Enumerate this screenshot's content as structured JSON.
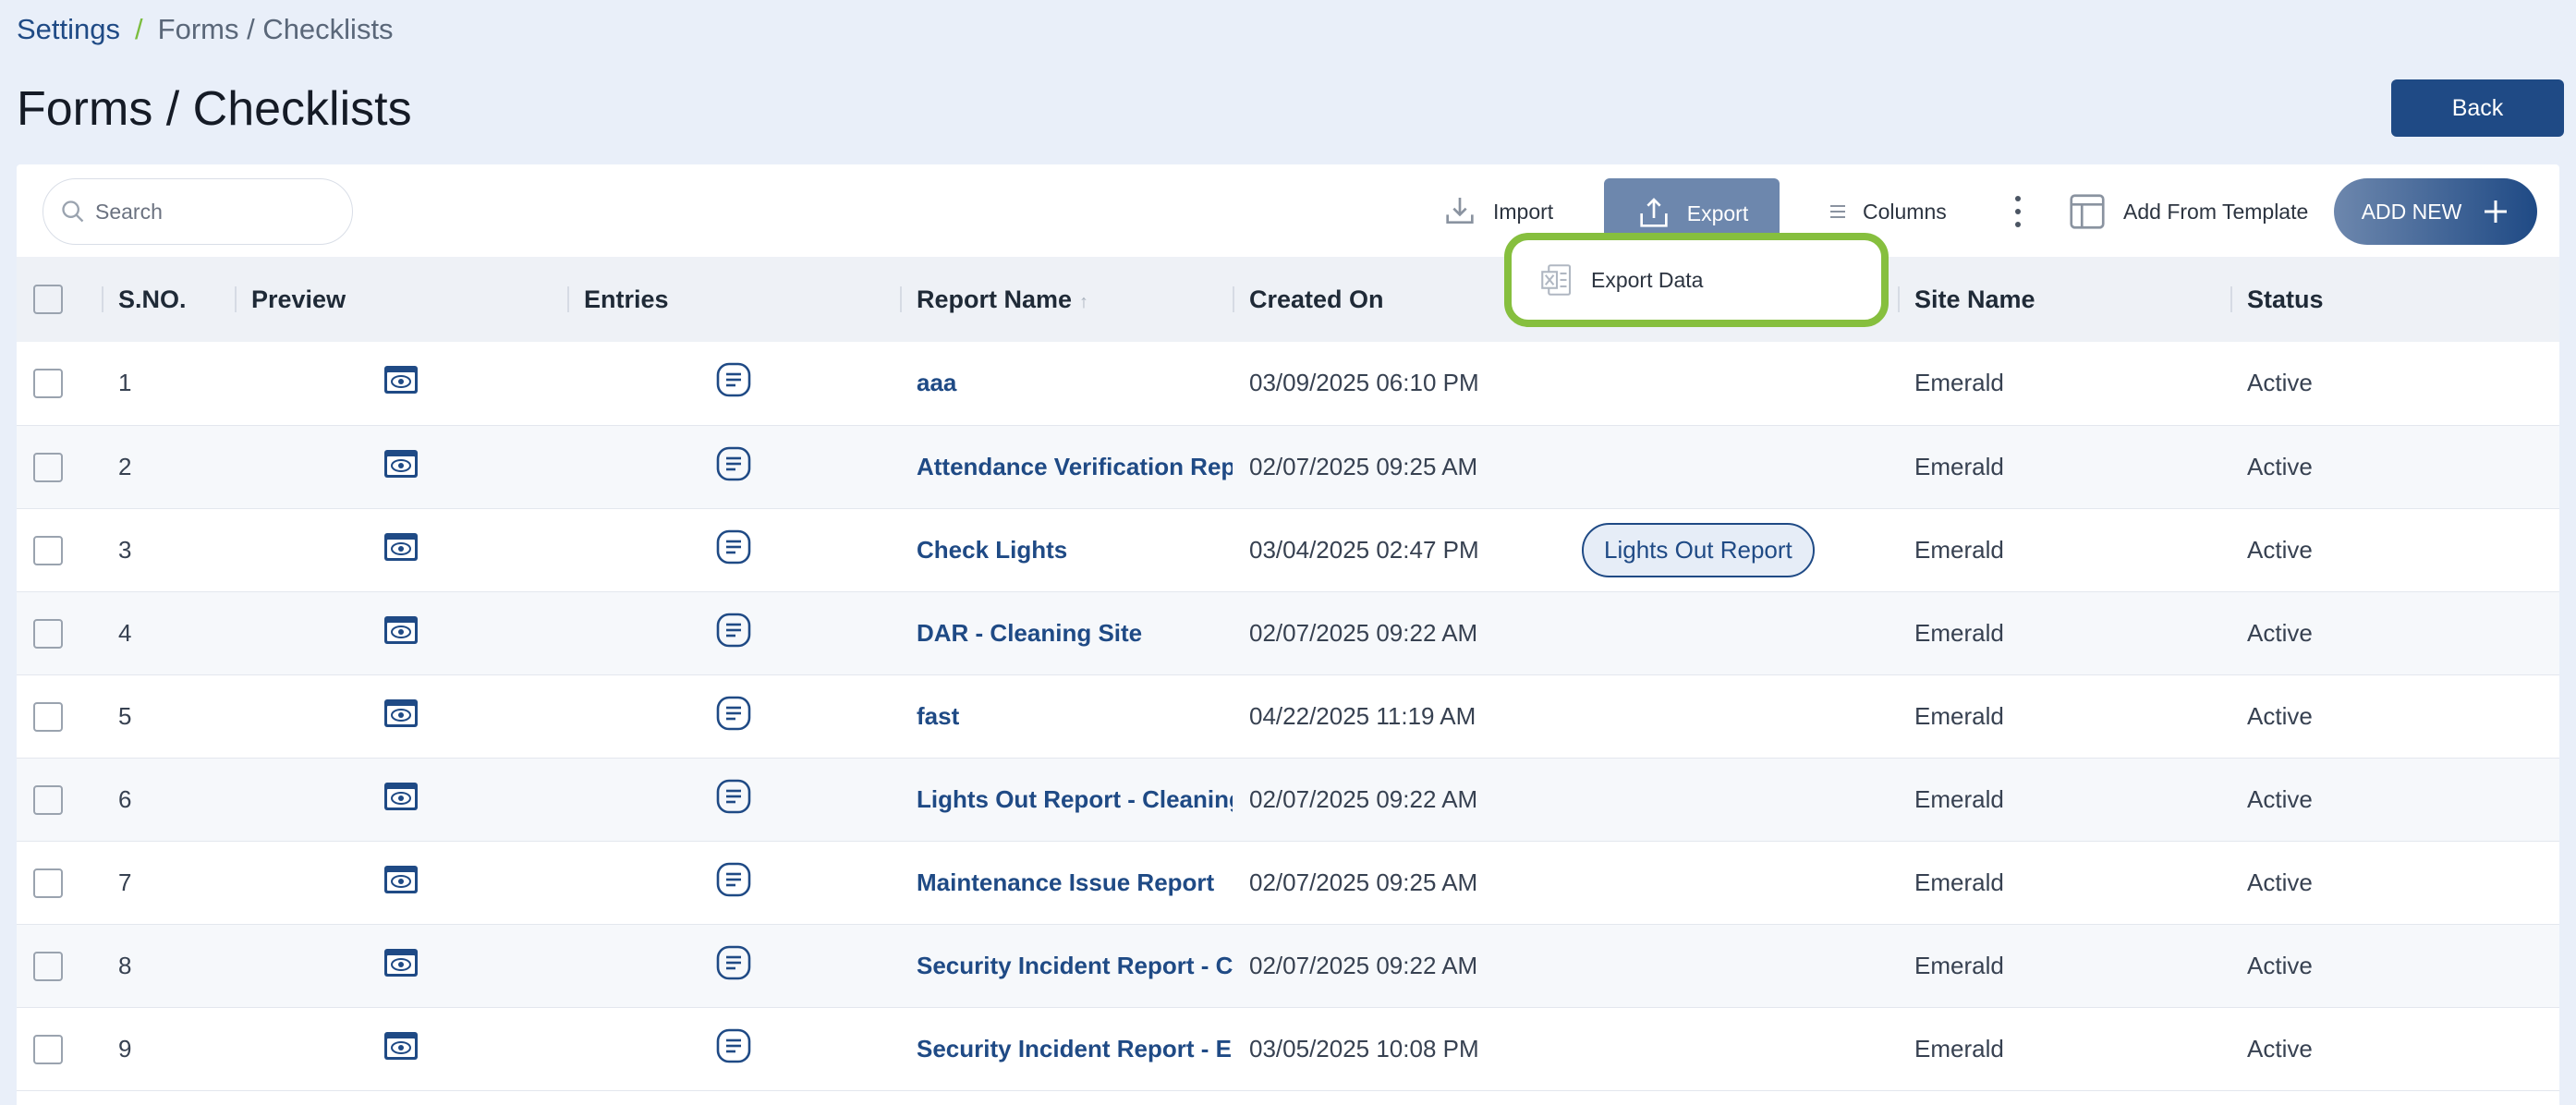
{
  "breadcrumb": {
    "root": "Settings",
    "separator": "/",
    "current": "Forms / Checklists"
  },
  "page": {
    "title": "Forms / Checklists",
    "back_label": "Back"
  },
  "toolbar": {
    "search_placeholder": "Search",
    "import_label": "Import",
    "export_label": "Export",
    "columns_label": "Columns",
    "template_label": "Add From Template",
    "add_new_label": "ADD NEW"
  },
  "export_menu": {
    "item_label": "Export Data"
  },
  "table": {
    "headers": [
      "S.NO.",
      "Preview",
      "Entries",
      "Report Name",
      "Created On",
      "",
      "Site Name",
      "Status"
    ],
    "rows": [
      {
        "sno": "1",
        "name": "aaa",
        "created": "03/09/2025 06:10 PM",
        "tag": "",
        "site": "Emerald",
        "status": "Active"
      },
      {
        "sno": "2",
        "name": "Attendance Verification Rep",
        "created": "02/07/2025 09:25 AM",
        "tag": "",
        "site": "Emerald",
        "status": "Active"
      },
      {
        "sno": "3",
        "name": "Check Lights",
        "created": "03/04/2025 02:47 PM",
        "tag": "Lights Out Report",
        "site": "Emerald",
        "status": "Active"
      },
      {
        "sno": "4",
        "name": "DAR - Cleaning Site",
        "created": "02/07/2025 09:22 AM",
        "tag": "",
        "site": "Emerald",
        "status": "Active"
      },
      {
        "sno": "5",
        "name": "fast",
        "created": "04/22/2025 11:19 AM",
        "tag": "",
        "site": "Emerald",
        "status": "Active"
      },
      {
        "sno": "6",
        "name": "Lights Out Report - Cleaning",
        "created": "02/07/2025 09:22 AM",
        "tag": "",
        "site": "Emerald",
        "status": "Active"
      },
      {
        "sno": "7",
        "name": "Maintenance Issue Report",
        "created": "02/07/2025 09:25 AM",
        "tag": "",
        "site": "Emerald",
        "status": "Active"
      },
      {
        "sno": "8",
        "name": "Security Incident Report - Cl",
        "created": "02/07/2025 09:22 AM",
        "tag": "",
        "site": "Emerald",
        "status": "Active"
      },
      {
        "sno": "9",
        "name": "Security Incident Report - En",
        "created": "03/05/2025 10:08 PM",
        "tag": "",
        "site": "Emerald",
        "status": "Active"
      }
    ]
  },
  "icons": {
    "preview": "eye-window-icon",
    "entries": "list-icon",
    "import": "download-tray-icon",
    "export": "upload-tray-icon",
    "columns": "bars-icon",
    "template": "layout-icon",
    "add": "plus-icon",
    "search": "search-icon",
    "excel": "excel-file-icon"
  },
  "colors": {
    "brand": "#1f4a85",
    "highlight": "#86bf3e",
    "background": "#e9eff9"
  }
}
